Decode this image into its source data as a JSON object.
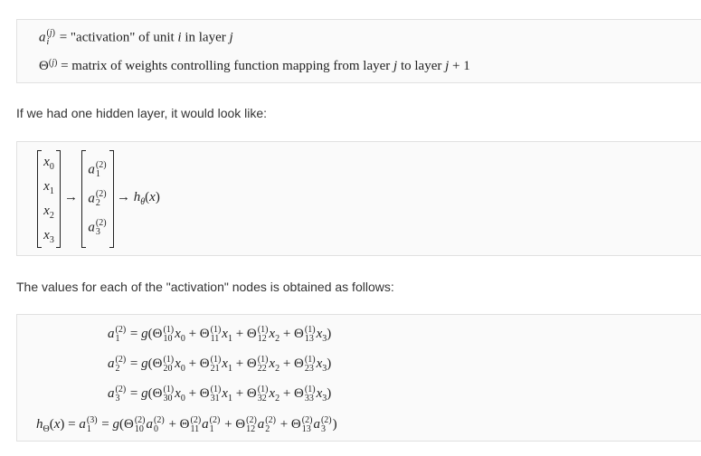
{
  "defs": {
    "line1_text": "= \"activation\" of unit i in layer j",
    "line2_text": "= matrix of weights controlling function mapping from layer j to layer j + 1"
  },
  "para1": "If we had one hidden layer, it would look like:",
  "para2": "The values for each of the \"activation\" nodes is obtained as follows:",
  "network": {
    "inputs": [
      "x0",
      "x1",
      "x2",
      "x3"
    ],
    "hidden": [
      "a1(2)",
      "a2(2)",
      "a3(2)"
    ],
    "output": "hθ(x)"
  },
  "equations": [
    "a1(2) = g(Θ10(1) x0 + Θ11(1) x1 + Θ12(1) x2 + Θ13(1) x3)",
    "a2(2) = g(Θ20(1) x0 + Θ21(1) x1 + Θ22(1) x2 + Θ23(1) x3)",
    "a3(2) = g(Θ30(1) x0 + Θ31(1) x1 + Θ32(1) x2 + Θ33(1) x3)",
    "hΘ(x) = a1(3) = g(Θ10(2) a0(2) + Θ11(2) a1(2) + Θ12(2) a2(2) + Θ13(2) a3(2))"
  ]
}
